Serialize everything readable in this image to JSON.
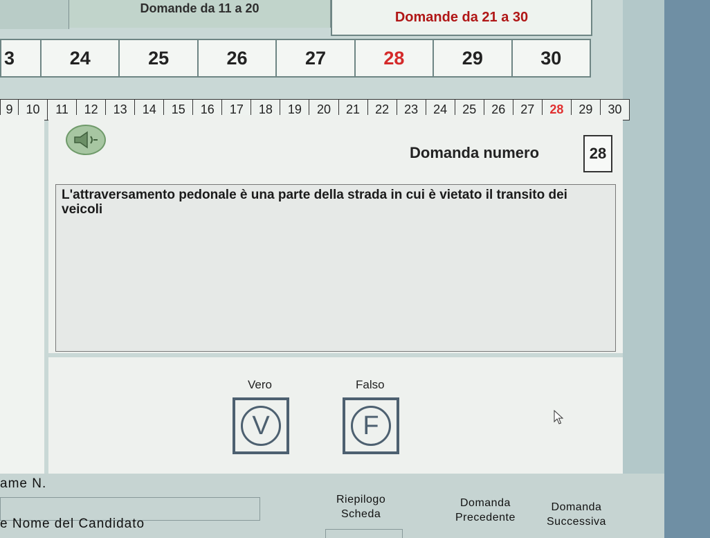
{
  "tabs": {
    "group_11_20": "Domande da 11 a 20",
    "group_21_30": "Domande da 21 a 30"
  },
  "big_nav": {
    "items": [
      "3",
      "24",
      "25",
      "26",
      "27",
      "28",
      "29",
      "30"
    ],
    "active": "28"
  },
  "small_nav": {
    "items": [
      "9",
      "10",
      "11",
      "12",
      "13",
      "14",
      "15",
      "16",
      "17",
      "18",
      "19",
      "20",
      "21",
      "22",
      "23",
      "24",
      "25",
      "26",
      "27",
      "28",
      "29",
      "30"
    ],
    "active": "28"
  },
  "question": {
    "label": "Domanda numero",
    "number": "28",
    "text": "L'attraversamento pedonale è una parte della strada in cui è vietato il transito dei veicoli"
  },
  "answers": {
    "true_label": "Vero",
    "true_symbol": "V",
    "false_label": "Falso",
    "false_symbol": "F"
  },
  "footer": {
    "name_label": "ame N.",
    "candidate_label": "e Nome del Candidato",
    "summary_line1": "Riepilogo",
    "summary_line2": "Scheda",
    "prev_line1": "Domanda",
    "prev_line2": "Precedente",
    "next_line1": "Domanda",
    "next_line2": "Successiva"
  },
  "icons": {
    "speaker": "speaker-icon",
    "cursor": "mouse-cursor-icon"
  },
  "colors": {
    "active_number": "#d42a2a",
    "tab_text_active": "#b01616",
    "button_border": "#4d6070"
  }
}
